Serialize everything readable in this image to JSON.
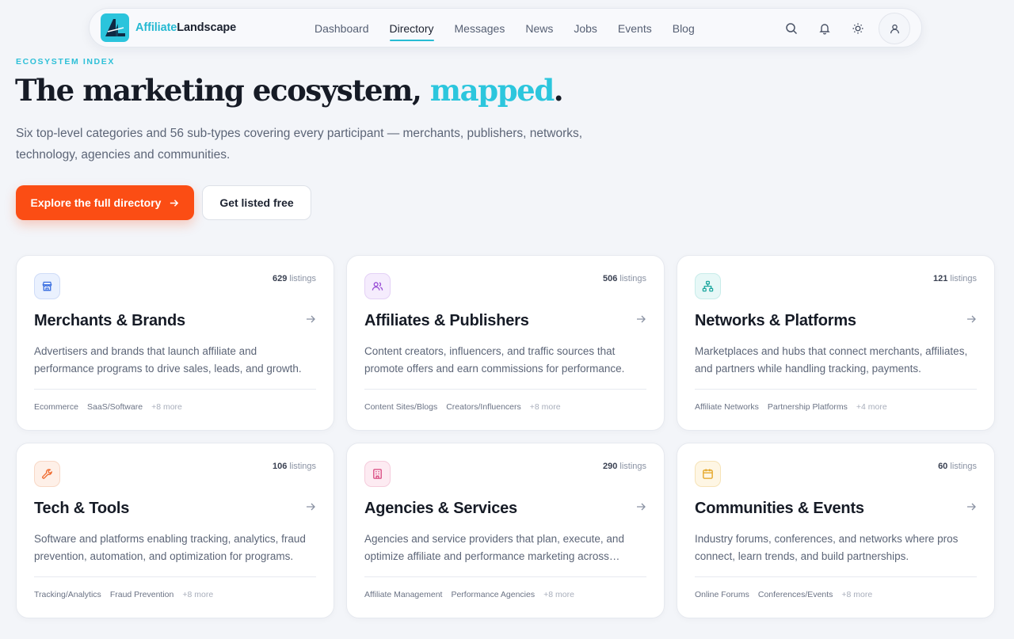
{
  "brand": {
    "part1": "Affiliate",
    "part2": "Landscape"
  },
  "nav": [
    {
      "label": "Dashboard"
    },
    {
      "label": "Directory",
      "active": true
    },
    {
      "label": "Messages"
    },
    {
      "label": "News"
    },
    {
      "label": "Jobs"
    },
    {
      "label": "Events"
    },
    {
      "label": "Blog"
    }
  ],
  "actions": {
    "search": "search-icon",
    "notifications": "bell-icon",
    "theme": "sun-icon",
    "account": "user-icon"
  },
  "hero": {
    "eyebrow": "ECOSYSTEM INDEX",
    "title_main": "The marketing ecosystem, ",
    "title_accent": "mapped",
    "title_end": ".",
    "subtitle": "Six top-level categories and 56 sub-types covering every participant — merchants, publishers, networks, technology, agencies and communities.",
    "primary_cta": "Explore the full directory",
    "secondary_cta": "Get listed free"
  },
  "colors": {
    "accent": "#2cc6dd",
    "cta": "#fb4d14"
  },
  "listings_suffix": "listings",
  "categories": [
    {
      "title": "Merchants & Brands",
      "count": "629",
      "description": "Advertisers and brands that launch affiliate and performance programs to drive sales, leads, and growth.",
      "tags": [
        "Ecommerce",
        "SaaS/Software"
      ],
      "more": "+8 more",
      "icon": "store-icon",
      "icon_color": "#3b6fe0",
      "icon_bg": "#eaf1fe",
      "icon_border": "#cfdcf8"
    },
    {
      "title": "Affiliates & Publishers",
      "count": "506",
      "description": "Content creators, influencers, and traffic sources that promote offers and earn commissions for performance.",
      "tags": [
        "Content Sites/Blogs",
        "Creators/Influencers"
      ],
      "more": "+8 more",
      "icon": "users-icon",
      "icon_color": "#9a4fd6",
      "icon_bg": "#f5ecfd",
      "icon_border": "#e4d1f6"
    },
    {
      "title": "Networks & Platforms",
      "count": "121",
      "description": "Marketplaces and hubs that connect merchants, affiliates, and partners while handling tracking, payments.",
      "tags": [
        "Affiliate Networks",
        "Partnership Platforms"
      ],
      "more": "+4 more",
      "icon": "network-icon",
      "icon_color": "#1fa8a0",
      "icon_bg": "#e7f8f7",
      "icon_border": "#c8ecea"
    },
    {
      "title": "Tech & Tools",
      "count": "106",
      "description": "Software and platforms enabling tracking, analytics, fraud prevention, automation, and optimization for programs.",
      "tags": [
        "Tracking/Analytics",
        "Fraud Prevention"
      ],
      "more": "+8 more",
      "icon": "wrench-icon",
      "icon_color": "#ef6a2e",
      "icon_bg": "#fef0e8",
      "icon_border": "#f8d8c6"
    },
    {
      "title": "Agencies & Services",
      "count": "290",
      "description": "Agencies and service providers that plan, execute, and optimize affiliate and performance marketing across channels.",
      "tags": [
        "Affiliate Management",
        "Performance Agencies"
      ],
      "more": "+8 more",
      "icon": "building-icon",
      "icon_color": "#d8477e",
      "icon_bg": "#fdebf2",
      "icon_border": "#f5ccdc"
    },
    {
      "title": "Communities & Events",
      "count": "60",
      "description": "Industry forums, conferences, and networks where pros connect, learn trends, and build partnerships.",
      "tags": [
        "Online Forums",
        "Conferences/Events"
      ],
      "more": "+8 more",
      "icon": "calendar-icon",
      "icon_color": "#e3a21d",
      "icon_bg": "#fef6e4",
      "icon_border": "#f6e3b7"
    }
  ]
}
